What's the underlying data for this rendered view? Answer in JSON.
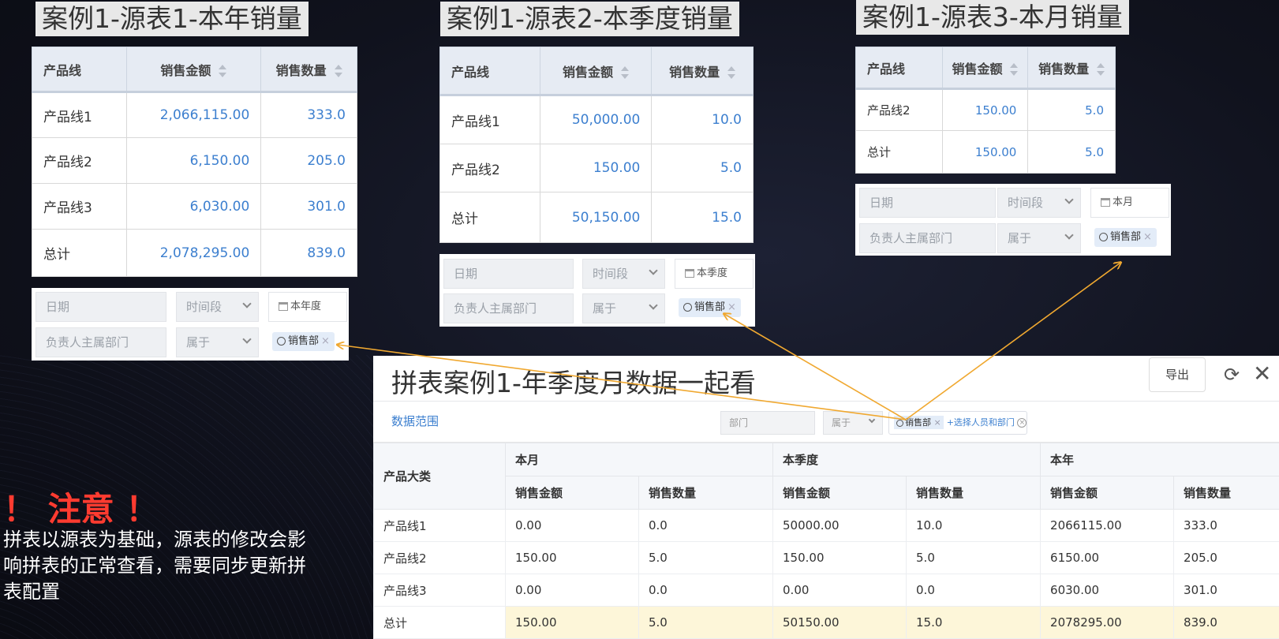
{
  "source1": {
    "title": "案例1-源表1-本年销量",
    "headers": [
      "产品线",
      "销售金额",
      "销售数量"
    ],
    "rows": [
      [
        "产品线1",
        "2,066,115.00",
        "333.0"
      ],
      [
        "产品线2",
        "6,150.00",
        "205.0"
      ],
      [
        "产品线3",
        "6,030.00",
        "301.0"
      ],
      [
        "总计",
        "2,078,295.00",
        "839.0"
      ]
    ],
    "filter": {
      "date_label": "日期",
      "date_op": "时间段",
      "date_value": "本年度",
      "dept_label": "负责人主属部门",
      "dept_op": "属于",
      "dept_value": "销售部"
    }
  },
  "source2": {
    "title": "案例1-源表2-本季度销量",
    "headers": [
      "产品线",
      "销售金额",
      "销售数量"
    ],
    "rows": [
      [
        "产品线1",
        "50,000.00",
        "10.0"
      ],
      [
        "产品线2",
        "150.00",
        "5.0"
      ],
      [
        "总计",
        "50,150.00",
        "15.0"
      ]
    ],
    "filter": {
      "date_label": "日期",
      "date_op": "时间段",
      "date_value": "本季度",
      "dept_label": "负责人主属部门",
      "dept_op": "属于",
      "dept_value": "销售部"
    }
  },
  "source3": {
    "title": "案例1-源表3-本月销量",
    "headers": [
      "产品线",
      "销售金额",
      "销售数量"
    ],
    "rows": [
      [
        "产品线2",
        "150.00",
        "5.0"
      ],
      [
        "总计",
        "150.00",
        "5.0"
      ]
    ],
    "filter": {
      "date_label": "日期",
      "date_op": "时间段",
      "date_value": "本月",
      "dept_label": "负责人主属部门",
      "dept_op": "属于",
      "dept_value": "销售部"
    }
  },
  "notice": {
    "title": "！ 注意 ！",
    "body": "拼表以源表为基础，源表的修改会影响拼表的正常查看，需要同步更新拼表配置"
  },
  "combined": {
    "title": "拼表案例1-年季度月数据一起看",
    "export_label": "导出",
    "refresh_icon": "⟳",
    "close_icon": "✕",
    "range_label": "数据范围",
    "range_field": "部门",
    "range_op": "属于",
    "range_tag": "销售部",
    "range_add": "+选择人员和部门",
    "category_header": "产品大类",
    "groups": [
      "本月",
      "本季度",
      "本年"
    ],
    "sub_headers": [
      "销售金额",
      "销售数量"
    ],
    "rows": [
      [
        "产品线1",
        "0.00",
        "0.0",
        "50000.00",
        "10.0",
        "2066115.00",
        "333.0"
      ],
      [
        "产品线2",
        "150.00",
        "5.0",
        "150.00",
        "5.0",
        "6150.00",
        "205.0"
      ],
      [
        "产品线3",
        "0.00",
        "0.0",
        "0.00",
        "0.0",
        "6030.00",
        "301.0"
      ],
      [
        "总计",
        "150.00",
        "5.0",
        "50150.00",
        "15.0",
        "2078295.00",
        "839.0"
      ]
    ]
  },
  "colors": {
    "link": "#3c7fcf",
    "notice": "#ff3b30",
    "arrow": "#f0a830",
    "total_row": "#fdf6d9"
  }
}
